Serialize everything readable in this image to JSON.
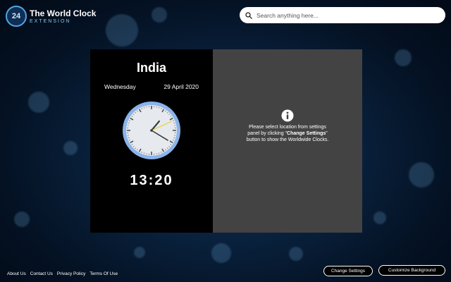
{
  "logo": {
    "badge": "24",
    "title": "The World Clock",
    "subtitle": "EXTENSION",
    "accent": "#4fa6e6"
  },
  "search": {
    "placeholder": "Search anything here...",
    "value": "",
    "icon": "search-icon"
  },
  "clock_panel": {
    "country": "India",
    "day": "Wednesday",
    "date": "29 April 2020",
    "time": "13:20",
    "analog": {
      "hours": 13,
      "minutes": 20,
      "seconds": 11
    },
    "colors": {
      "face": "#e6e9ee",
      "rim": "#8ab4ea",
      "second_hand": "#e7d21e",
      "hands": "#3a3a3a"
    }
  },
  "info_panel": {
    "icon": "info-icon",
    "line_pre": "Please select location from settings panel by clicking \"",
    "bold": "Change Settings",
    "line_post": "\" button to show the Worldwide Clocks."
  },
  "footer": {
    "links": [
      "About Us",
      "Contact Us",
      "Privacy Policy",
      "Terms Of Use"
    ]
  },
  "buttons": {
    "change_settings": "Change Settings",
    "customize_background": "Customize Background"
  }
}
